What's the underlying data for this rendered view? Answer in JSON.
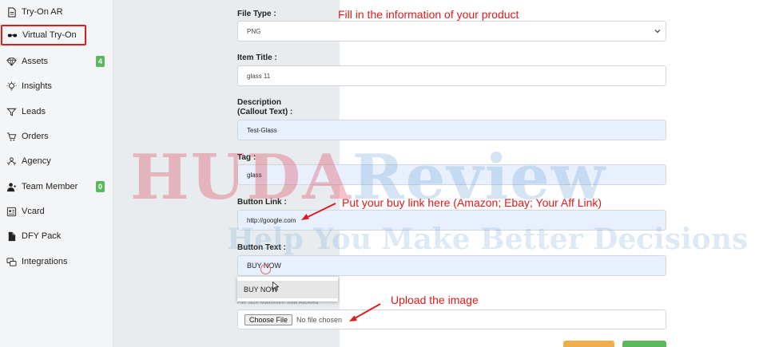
{
  "sidebar": {
    "items": [
      {
        "label": "Try-On AR",
        "icon": "file-icon"
      },
      {
        "label": "Virtual Try-On",
        "icon": "glasses-icon"
      },
      {
        "label": "Assets",
        "icon": "diamond-icon",
        "badge": "4"
      },
      {
        "label": "Insights",
        "icon": "lightbulb-icon"
      },
      {
        "label": "Leads",
        "icon": "funnel-icon"
      },
      {
        "label": "Orders",
        "icon": "cart-icon"
      },
      {
        "label": "Agency",
        "icon": "agency-icon"
      },
      {
        "label": "Team Member",
        "icon": "user-icon",
        "badge": "0"
      },
      {
        "label": "Vcard",
        "icon": "id-card-icon"
      },
      {
        "label": "DFY Pack",
        "icon": "file-solid-icon"
      },
      {
        "label": "Integrations",
        "icon": "integrations-icon"
      }
    ]
  },
  "form": {
    "file_type": {
      "label": "File Type :",
      "value": "PNG"
    },
    "item_title": {
      "label": "Item Title :",
      "value": "glass 11"
    },
    "description": {
      "label_line1": "Description",
      "label_line2": "(Callout Text) :",
      "value": "Test-Glass"
    },
    "tag": {
      "label": "Tag :",
      "value": "glass"
    },
    "button_link": {
      "label": "Button Link :",
      "value": "http://google.com"
    },
    "button_text": {
      "label": "Button Text :",
      "value": "BUY NOW",
      "suggestion": "BUY NOW"
    },
    "image": {
      "sub_label": "File Size Maximum 5MB Allowed",
      "choose_label": "Choose File",
      "status": "No file chosen"
    }
  },
  "annotations": {
    "top": "Fill in the information of your product",
    "link": "Put your buy link here (Amazon; Ebay; Your Aff Link)",
    "upload": "Upload the image"
  },
  "watermark": {
    "brand_part1": "HUDA",
    "brand_part2": "Review",
    "tagline": "Help You Make Better Decisions"
  },
  "colors": {
    "highlight": "#e01b1b",
    "badge": "#5cb85c",
    "accent_orange": "#f0ad4e",
    "accent_green": "#5cb85c",
    "autofill": "#e8f0fe"
  }
}
